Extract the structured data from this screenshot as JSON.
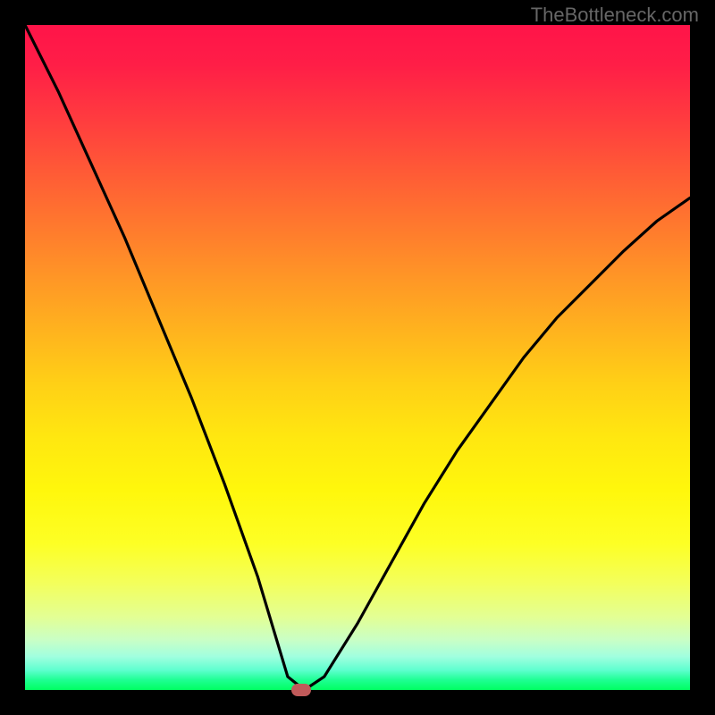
{
  "watermark": "TheBottleneck.com",
  "chart_data": {
    "type": "line",
    "title": "",
    "xlabel": "",
    "ylabel": "",
    "xlim": [
      0,
      1
    ],
    "ylim": [
      0,
      1
    ],
    "gradient_meaning": "red-high to green-low bottleneck severity, y-decreasing = better",
    "series": [
      {
        "name": "bottleneck-curve",
        "x": [
          0.0,
          0.05,
          0.1,
          0.15,
          0.2,
          0.25,
          0.3,
          0.35,
          0.395,
          0.42,
          0.45,
          0.5,
          0.55,
          0.6,
          0.65,
          0.7,
          0.75,
          0.8,
          0.85,
          0.9,
          0.95,
          1.0
        ],
        "y": [
          1.0,
          0.9,
          0.79,
          0.68,
          0.56,
          0.44,
          0.31,
          0.17,
          0.02,
          0.0,
          0.02,
          0.1,
          0.19,
          0.28,
          0.36,
          0.43,
          0.5,
          0.56,
          0.61,
          0.66,
          0.705,
          0.74
        ]
      }
    ],
    "minimum_marker": {
      "x": 0.415,
      "y": 0.0
    },
    "colors": {
      "curve": "#000000",
      "marker": "#c05a5a",
      "frame": "#000000"
    }
  }
}
